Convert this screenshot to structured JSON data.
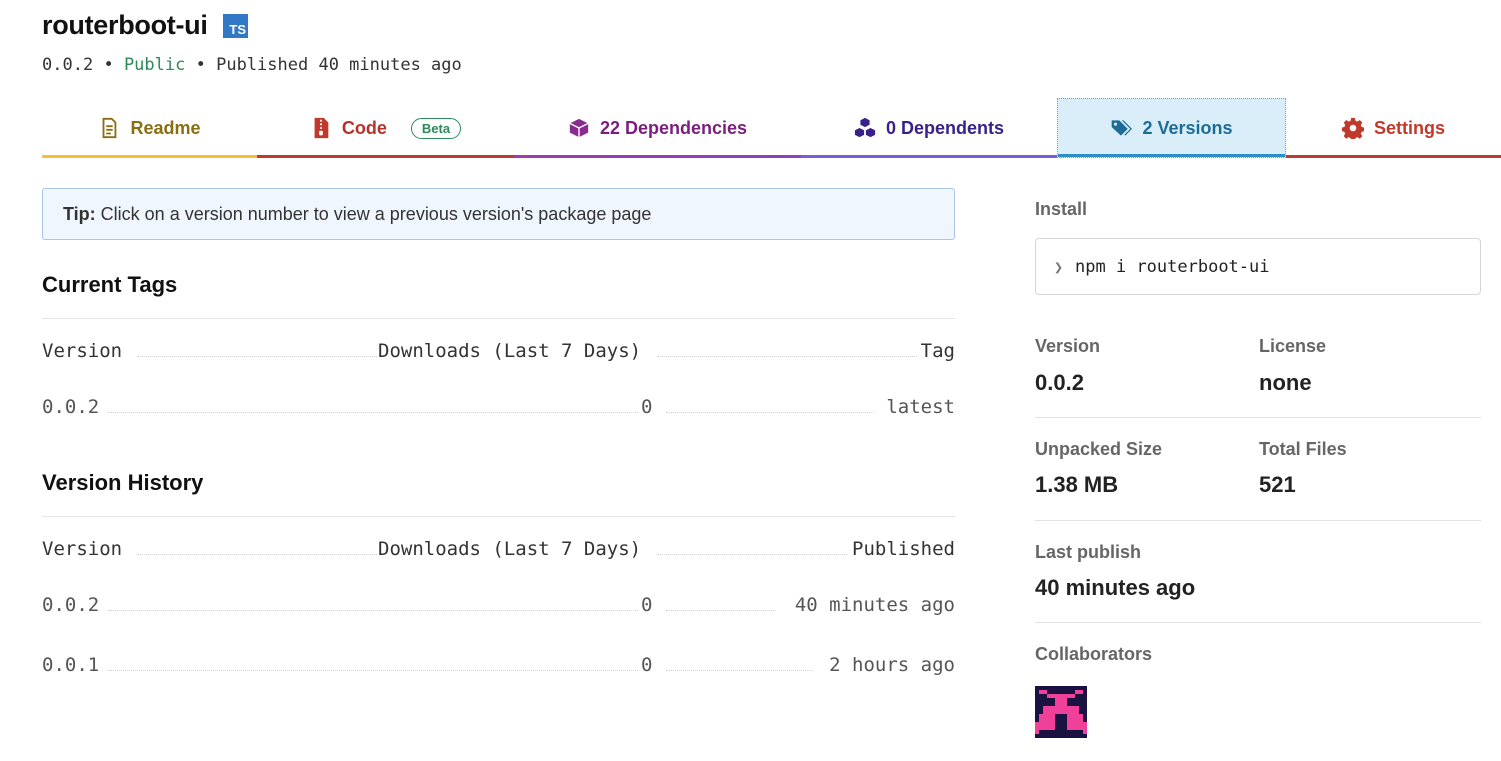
{
  "package": {
    "name": "routerboot-ui",
    "types_badge": "TS",
    "version": "0.0.2",
    "bullet": "•",
    "visibility": "Public",
    "published": "Published 40 minutes ago"
  },
  "tabs": [
    {
      "label": "Readme",
      "icon": "readme-file-icon"
    },
    {
      "label": "Code",
      "badge": "Beta",
      "icon": "code-zip-icon"
    },
    {
      "label": "22 Dependencies",
      "icon": "box-icon"
    },
    {
      "label": "0 Dependents",
      "icon": "boxes-icon"
    },
    {
      "label": "2 Versions",
      "icon": "tags-icon",
      "active": true
    },
    {
      "label": "Settings",
      "icon": "gear-icon"
    }
  ],
  "tip": {
    "bold": "Tip:",
    "text": "Click on a version number to view a previous version's package page"
  },
  "current_tags": {
    "title": "Current Tags",
    "headers": [
      "Version",
      "Downloads (Last 7 Days)",
      "Tag"
    ],
    "rows": [
      {
        "version": "0.0.2",
        "downloads": "0",
        "tag": "latest"
      }
    ]
  },
  "version_history": {
    "title": "Version History",
    "headers": [
      "Version",
      "Downloads (Last 7 Days)",
      "Published"
    ],
    "rows": [
      {
        "version": "0.0.2",
        "downloads": "0",
        "published": "40 minutes ago"
      },
      {
        "version": "0.0.1",
        "downloads": "0",
        "published": "2 hours ago"
      }
    ]
  },
  "sidebar": {
    "install_label": "Install",
    "install_prompt": "❯",
    "install_command": "npm i routerboot-ui",
    "version_label": "Version",
    "version_value": "0.0.2",
    "license_label": "License",
    "license_value": "none",
    "unpacked_size_label": "Unpacked Size",
    "unpacked_size_value": "1.38 MB",
    "total_files_label": "Total Files",
    "total_files_value": "521",
    "last_publish_label": "Last publish",
    "last_publish_value": "40 minutes ago",
    "collaborators_label": "Collaborators"
  },
  "colors": {
    "accent_versions": "#1d6c96",
    "public_green": "#2a8a59",
    "avatar_pink": "#f0409a",
    "avatar_dark": "#1a1240"
  }
}
